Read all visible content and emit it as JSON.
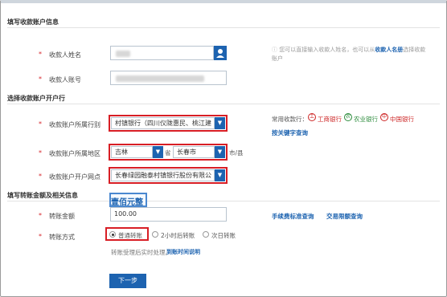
{
  "sections": {
    "payee_info": "填写收款账户信息",
    "payee_bank": "选择收款账户开户行",
    "amount_info": "填写转账金额及相关信息"
  },
  "fields": {
    "payee_name": {
      "label": "收款人姓名"
    },
    "payee_account": {
      "label": "收款人账号"
    },
    "payee_bank": {
      "label": "收款账户所属行别",
      "value": "村镇银行（四川仪陇惠民、桃江建"
    },
    "payee_region": {
      "label": "收款账户所属地区",
      "province": "吉林",
      "province_suffix": "省",
      "city": "长春市",
      "city_suffix": "市/县"
    },
    "payee_branch": {
      "label": "收款账户开户网点",
      "value": "长春绿园融泰村镇银行股份有限公"
    },
    "amount": {
      "label": "转账金额",
      "value": "100.00",
      "uppercase": "壹佰元整"
    },
    "method": {
      "label": "转账方式",
      "options": [
        "普通转账",
        "2小时后转账",
        "次日转账"
      ],
      "selected": "普通转账"
    }
  },
  "hints": {
    "payee_name_hint_prefix": "您可以直接输入收款人姓名，也可以从",
    "payee_name_link": "收款人名册",
    "payee_name_hint_suffix": "选择收款账户",
    "common_banks_label": "常用收款行：",
    "banks": [
      "工商银行",
      "农业银行",
      "中国银行"
    ],
    "keyword_search": "按关键字查询",
    "fee_query": "手续费标准查询",
    "limit_query": "交易限额查询",
    "realtime_note": "转账受理后实时处理。",
    "arrival_link": "到账时间说明"
  },
  "buttons": {
    "next": "下一步"
  },
  "colors": {
    "accent": "#1d63b0",
    "highlight": "#d81e25",
    "required": "#d6262b"
  },
  "icons": {
    "contact": "person-icon",
    "dropdown": "chevron-down-icon"
  }
}
